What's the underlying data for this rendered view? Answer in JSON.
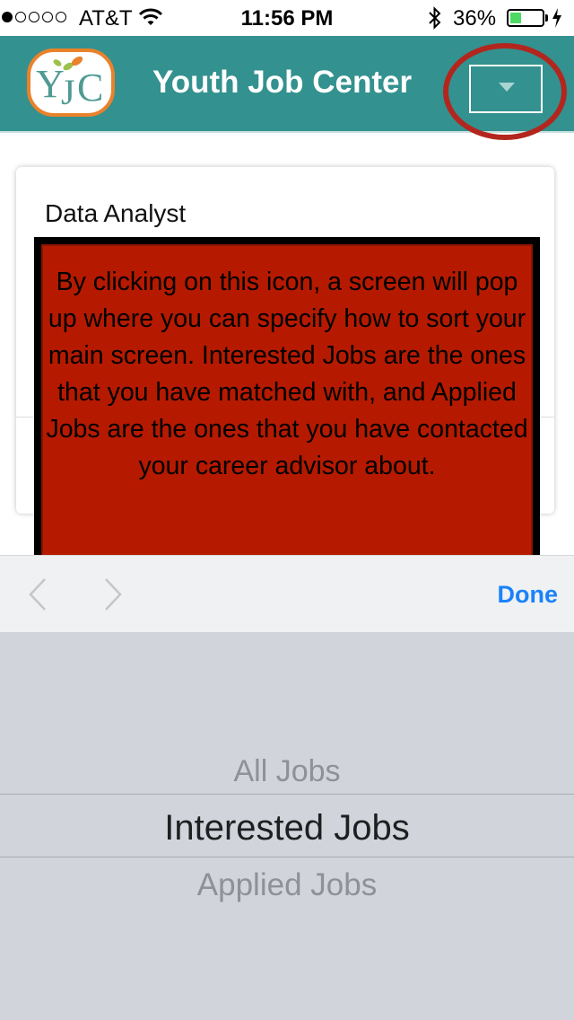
{
  "status_bar": {
    "carrier": "AT&T",
    "time": "11:56 PM",
    "battery_percent": "36%",
    "battery_level": 0.36,
    "signal_bars": 1,
    "icons": [
      "wifi-icon",
      "bluetooth-icon",
      "battery-icon",
      "charging-icon"
    ]
  },
  "nav": {
    "title": "Youth Job Center",
    "logo_text": "YJC",
    "dropdown_icon": "chevron-down-icon",
    "color": "#33918f"
  },
  "job_card": {
    "title": "Data Analyst"
  },
  "annotation": {
    "text": "By clicking on this icon, a screen will pop up where you can specify how to sort your main screen. Interested Jobs are the ones that you have matched with, and Applied Jobs are the ones that you have contacted your career advisor about.",
    "box_color": "#b51a00",
    "ring_color": "#b3261e"
  },
  "picker_toolbar": {
    "done_label": "Done",
    "prev_icon": "chevron-left-icon",
    "next_icon": "chevron-right-icon"
  },
  "picker": {
    "options": [
      "All Jobs",
      "Interested Jobs",
      "Applied Jobs"
    ],
    "selected": "Interested Jobs"
  }
}
